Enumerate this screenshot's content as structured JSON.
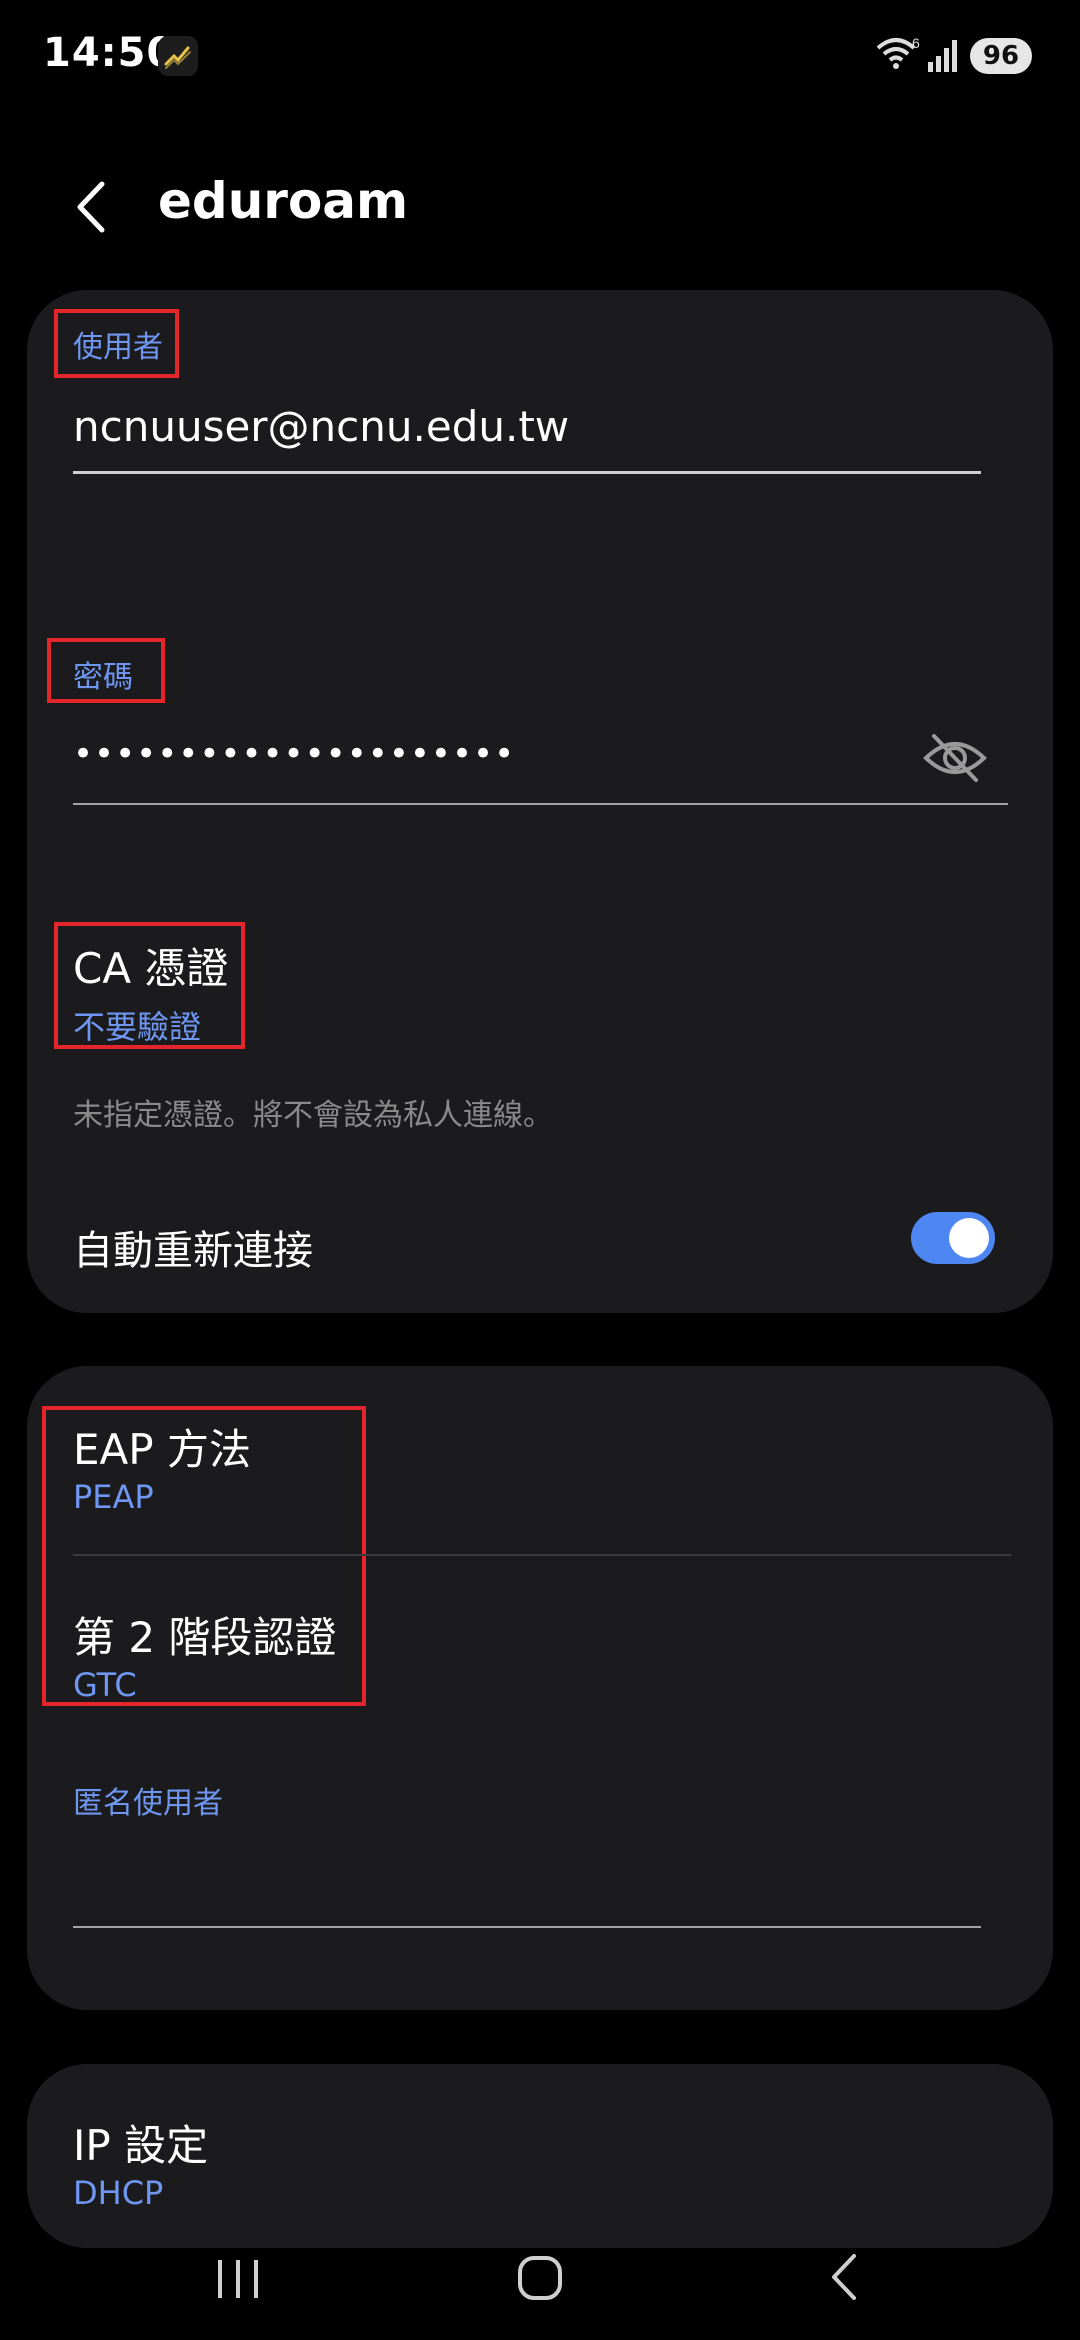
{
  "status_bar": {
    "time": "14:50",
    "battery": "96",
    "wifi_generation": "6"
  },
  "header": {
    "title": "eduroam"
  },
  "identity": {
    "label": "使用者",
    "value": "ncnuuser@ncnu.edu.tw"
  },
  "password": {
    "label": "密碼",
    "value": "•••••••••••••••••••••"
  },
  "ca_certificate": {
    "title": "CA 憑證",
    "value": "不要驗證",
    "helper": "未指定憑證。將不會設為私人連線。"
  },
  "auto_reconnect": {
    "label": "自動重新連接",
    "enabled": true
  },
  "eap_method": {
    "title": "EAP 方法",
    "value": "PEAP"
  },
  "phase2": {
    "title": "第 2 階段認證",
    "value": "GTC"
  },
  "anonymous_identity": {
    "label": "匿名使用者",
    "value": ""
  },
  "ip_settings": {
    "title": "IP 設定",
    "value": "DHCP"
  },
  "colors": {
    "background": "#000000",
    "card": "#1b1b1e",
    "accent_blue": "#6f96f0",
    "toggle_blue": "#4d86f0",
    "highlight_red": "#e4262c"
  }
}
